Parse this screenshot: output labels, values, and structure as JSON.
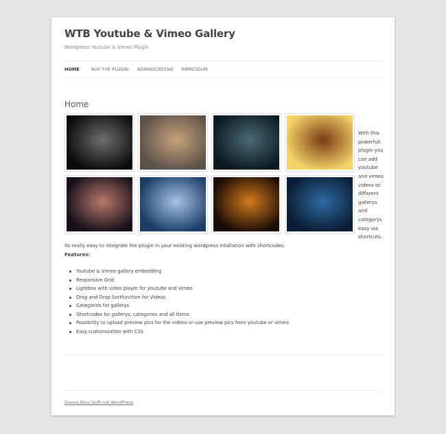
{
  "site": {
    "title": "WTB Youtube & Vimeo Gallery",
    "description": "Wordpress Youtube & Vimeo Plugin"
  },
  "nav": {
    "items": [
      {
        "label": "HOME",
        "active": true
      },
      {
        "label": "BUY THE PLUGIN",
        "active": false
      },
      {
        "label": "ADMINSCREENS",
        "active": false
      },
      {
        "label": "IMPRESSUM",
        "active": false
      }
    ]
  },
  "page": {
    "title": "Home"
  },
  "gallery": {
    "thumbnails": [
      {
        "name": "thumb-woman-portrait",
        "colors": [
          "#0c0c0c",
          "#6e6e6e"
        ]
      },
      {
        "name": "thumb-soldier-battle",
        "colors": [
          "#5b524a",
          "#c7a27a"
        ]
      },
      {
        "name": "thumb-soldiers-dark",
        "colors": [
          "#0d1a20",
          "#4a6a72"
        ]
      },
      {
        "name": "thumb-forest-sun",
        "colors": [
          "#f3d36a",
          "#7b3c14"
        ]
      },
      {
        "name": "thumb-toast-fireworks",
        "colors": [
          "#17101a",
          "#b87a6c"
        ]
      },
      {
        "name": "thumb-blue-swordsman",
        "colors": [
          "#1c3d66",
          "#a6c3e3"
        ]
      },
      {
        "name": "thumb-colorful-mask",
        "colors": [
          "#1a0c06",
          "#d27a1c"
        ]
      },
      {
        "name": "thumb-blue-forest",
        "colors": [
          "#0a1c33",
          "#2e6aa0"
        ]
      }
    ],
    "side_text": "With this powerfull plugin you can add youtube and vimeo videos to different gallerys and categorys easy via shortcuts."
  },
  "content": {
    "intro": "Its really easy to integrate the plugin in your existing wordpress intallation with shortcodes.",
    "features_label": "Features:",
    "features": [
      "Youtube & Vimeo gallery embedding",
      "Responsive Grid",
      "Lightbox with video player for youtube and vimeo",
      "Drag and Drop Sortfunction for Videos",
      "Categories for gallerys",
      "Shortcodes for gallerys, categories and all items",
      "Possibility to upload preview pics for the videos or use preview pics from youtube or vimeo",
      "Easy customization with CSS"
    ]
  },
  "footer": {
    "link": "Dieses Blog läuft mit WordPress"
  }
}
